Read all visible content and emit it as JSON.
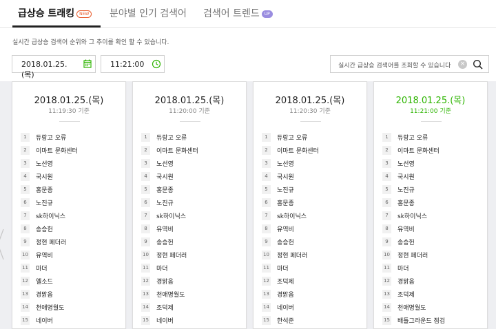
{
  "tabs": [
    {
      "label": "급상승 트래킹",
      "badge": "NEW",
      "active": true
    },
    {
      "label": "분야별 인기 검색어",
      "badge": "",
      "active": false
    },
    {
      "label": "검색어 트렌드",
      "badge": "UP",
      "active": false
    }
  ],
  "description": "실시간 급상승 검색어 순위와 그 추이를 확인 할 수 있습니다.",
  "filters": {
    "date": "2018.01.25. (목)",
    "time": "11:21:00",
    "search_placeholder": "실시간 급상승 검색어를 조회할 수 있습니다"
  },
  "columns": [
    {
      "date": "2018.01.25.(목)",
      "time": "11:19:30 기준",
      "latest": false,
      "items": [
        {
          "rank": "1",
          "keyword": "듀랑고 오류"
        },
        {
          "rank": "2",
          "keyword": "이마트 문화센터"
        },
        {
          "rank": "3",
          "keyword": "노선영"
        },
        {
          "rank": "4",
          "keyword": "국시원"
        },
        {
          "rank": "5",
          "keyword": "홍문종"
        },
        {
          "rank": "6",
          "keyword": "노진규"
        },
        {
          "rank": "7",
          "keyword": "sk하이닉스"
        },
        {
          "rank": "8",
          "keyword": "송승헌"
        },
        {
          "rank": "9",
          "keyword": "정현 페더러"
        },
        {
          "rank": "10",
          "keyword": "유역비"
        },
        {
          "rank": "11",
          "keyword": "마더"
        },
        {
          "rank": "12",
          "keyword": "엘소드"
        },
        {
          "rank": "13",
          "keyword": "경맑음"
        },
        {
          "rank": "14",
          "keyword": "천애명월도"
        },
        {
          "rank": "15",
          "keyword": "네이버"
        }
      ]
    },
    {
      "date": "2018.01.25.(목)",
      "time": "11:20:00 기준",
      "latest": false,
      "items": [
        {
          "rank": "1",
          "keyword": "듀랑고 오류"
        },
        {
          "rank": "2",
          "keyword": "이마트 문화센터"
        },
        {
          "rank": "3",
          "keyword": "노선영"
        },
        {
          "rank": "4",
          "keyword": "국시원"
        },
        {
          "rank": "5",
          "keyword": "홍문종"
        },
        {
          "rank": "6",
          "keyword": "노진규"
        },
        {
          "rank": "7",
          "keyword": "sk하이닉스"
        },
        {
          "rank": "8",
          "keyword": "유역비"
        },
        {
          "rank": "9",
          "keyword": "송승헌"
        },
        {
          "rank": "10",
          "keyword": "정현 페더러"
        },
        {
          "rank": "11",
          "keyword": "마더"
        },
        {
          "rank": "12",
          "keyword": "경맑음"
        },
        {
          "rank": "13",
          "keyword": "천애명월도"
        },
        {
          "rank": "14",
          "keyword": "조덕제"
        },
        {
          "rank": "15",
          "keyword": "네이버"
        }
      ]
    },
    {
      "date": "2018.01.25.(목)",
      "time": "11:20:30 기준",
      "latest": false,
      "items": [
        {
          "rank": "1",
          "keyword": "듀랑고 오류"
        },
        {
          "rank": "2",
          "keyword": "이마트 문화센터"
        },
        {
          "rank": "3",
          "keyword": "노선영"
        },
        {
          "rank": "4",
          "keyword": "국시원"
        },
        {
          "rank": "5",
          "keyword": "노진규"
        },
        {
          "rank": "6",
          "keyword": "홍문종"
        },
        {
          "rank": "7",
          "keyword": "sk하이닉스"
        },
        {
          "rank": "8",
          "keyword": "유역비"
        },
        {
          "rank": "9",
          "keyword": "송승헌"
        },
        {
          "rank": "10",
          "keyword": "정현 페더러"
        },
        {
          "rank": "11",
          "keyword": "마더"
        },
        {
          "rank": "12",
          "keyword": "조덕제"
        },
        {
          "rank": "13",
          "keyword": "경맑음"
        },
        {
          "rank": "14",
          "keyword": "네이버"
        },
        {
          "rank": "15",
          "keyword": "한석준"
        }
      ]
    },
    {
      "date": "2018.01.25.(목)",
      "time": "11:21:00 기준",
      "latest": true,
      "items": [
        {
          "rank": "1",
          "keyword": "듀랑고 오류"
        },
        {
          "rank": "2",
          "keyword": "이마트 문화센터"
        },
        {
          "rank": "3",
          "keyword": "노선영"
        },
        {
          "rank": "4",
          "keyword": "국시원"
        },
        {
          "rank": "5",
          "keyword": "노진규"
        },
        {
          "rank": "6",
          "keyword": "홍문종"
        },
        {
          "rank": "7",
          "keyword": "sk하이닉스"
        },
        {
          "rank": "8",
          "keyword": "유역비"
        },
        {
          "rank": "9",
          "keyword": "송승헌"
        },
        {
          "rank": "10",
          "keyword": "정현 페더러"
        },
        {
          "rank": "11",
          "keyword": "마더"
        },
        {
          "rank": "12",
          "keyword": "경맑음"
        },
        {
          "rank": "13",
          "keyword": "조덕제"
        },
        {
          "rank": "14",
          "keyword": "천애명월도"
        },
        {
          "rank": "15",
          "keyword": "배틀그라운드 점검"
        }
      ]
    }
  ],
  "colors": {
    "accent_green": "#2db400",
    "new_badge": "#e85a2a",
    "up_badge": "#9a8de0"
  },
  "icons": {
    "calendar": "calendar-icon",
    "clock": "clock-icon",
    "clear": "clear-icon",
    "search": "search-icon"
  }
}
